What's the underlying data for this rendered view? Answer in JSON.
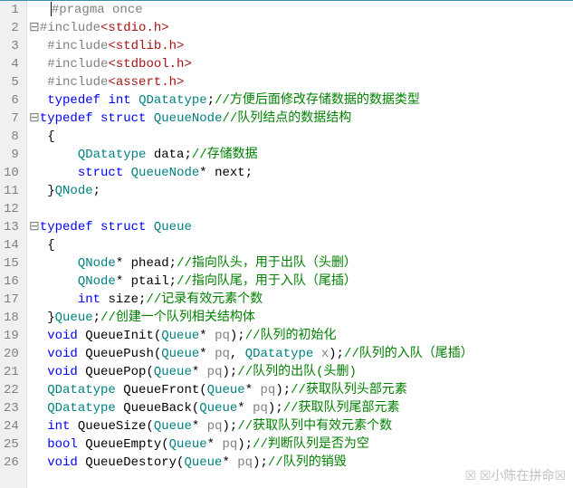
{
  "watermark": "☒ ☒小陈在拼命☒",
  "lines": [
    {
      "n": 1,
      "fold": "",
      "tokens": [
        {
          "t": "",
          "c": "fold"
        },
        {
          "t": "|",
          "c": "cursor"
        },
        {
          "t": "#pragma once",
          "c": "pp"
        }
      ]
    },
    {
      "n": 2,
      "fold": "⊟",
      "tokens": [
        {
          "t": "#include",
          "c": "pp"
        },
        {
          "t": "<stdio.h>",
          "c": "str"
        }
      ]
    },
    {
      "n": 3,
      "fold": "",
      "tokens": [
        {
          "t": " ",
          "c": ""
        },
        {
          "t": "#include",
          "c": "pp"
        },
        {
          "t": "<stdlib.h>",
          "c": "str"
        }
      ]
    },
    {
      "n": 4,
      "fold": "",
      "tokens": [
        {
          "t": " ",
          "c": ""
        },
        {
          "t": "#include",
          "c": "pp"
        },
        {
          "t": "<stdbool.h>",
          "c": "str"
        }
      ]
    },
    {
      "n": 5,
      "fold": "",
      "tokens": [
        {
          "t": " ",
          "c": ""
        },
        {
          "t": "#include",
          "c": "pp"
        },
        {
          "t": "<assert.h>",
          "c": "str"
        }
      ]
    },
    {
      "n": 6,
      "fold": "",
      "tokens": [
        {
          "t": " ",
          "c": ""
        },
        {
          "t": "typedef",
          "c": "kw"
        },
        {
          "t": " ",
          "c": ""
        },
        {
          "t": "int",
          "c": "kw"
        },
        {
          "t": " ",
          "c": ""
        },
        {
          "t": "QDatatype",
          "c": "type"
        },
        {
          "t": ";",
          "c": "op"
        },
        {
          "t": "//方便后面修改存储数据的数据类型",
          "c": "cmt"
        }
      ]
    },
    {
      "n": 7,
      "fold": "⊟",
      "tokens": [
        {
          "t": "typedef",
          "c": "kw"
        },
        {
          "t": " ",
          "c": ""
        },
        {
          "t": "struct",
          "c": "kw"
        },
        {
          "t": " ",
          "c": ""
        },
        {
          "t": "QueueNode",
          "c": "type"
        },
        {
          "t": "//队列结点的数据结构",
          "c": "cmt"
        }
      ]
    },
    {
      "n": 8,
      "fold": "",
      "tokens": [
        {
          "t": " {",
          "c": "op"
        }
      ]
    },
    {
      "n": 9,
      "fold": "",
      "tokens": [
        {
          "t": "     ",
          "c": ""
        },
        {
          "t": "QDatatype",
          "c": "type"
        },
        {
          "t": " data;",
          "c": "op"
        },
        {
          "t": "//存储数据",
          "c": "cmt"
        }
      ]
    },
    {
      "n": 10,
      "fold": "",
      "tokens": [
        {
          "t": "     ",
          "c": ""
        },
        {
          "t": "struct",
          "c": "kw"
        },
        {
          "t": " ",
          "c": ""
        },
        {
          "t": "QueueNode",
          "c": "type"
        },
        {
          "t": "* next;",
          "c": "op"
        }
      ]
    },
    {
      "n": 11,
      "fold": "",
      "tokens": [
        {
          "t": " }",
          "c": "op"
        },
        {
          "t": "QNode",
          "c": "type"
        },
        {
          "t": ";",
          "c": "op"
        }
      ]
    },
    {
      "n": 12,
      "fold": "",
      "tokens": [
        {
          "t": "",
          "c": ""
        }
      ]
    },
    {
      "n": 13,
      "fold": "⊟",
      "tokens": [
        {
          "t": "typedef",
          "c": "kw"
        },
        {
          "t": " ",
          "c": ""
        },
        {
          "t": "struct",
          "c": "kw"
        },
        {
          "t": " ",
          "c": ""
        },
        {
          "t": "Queue",
          "c": "type"
        }
      ]
    },
    {
      "n": 14,
      "fold": "",
      "tokens": [
        {
          "t": " {",
          "c": "op"
        }
      ]
    },
    {
      "n": 15,
      "fold": "",
      "tokens": [
        {
          "t": "     ",
          "c": ""
        },
        {
          "t": "QNode",
          "c": "type"
        },
        {
          "t": "* phead;",
          "c": "op"
        },
        {
          "t": "//指向队头，用于出队（头删）",
          "c": "cmt"
        }
      ]
    },
    {
      "n": 16,
      "fold": "",
      "tokens": [
        {
          "t": "     ",
          "c": ""
        },
        {
          "t": "QNode",
          "c": "type"
        },
        {
          "t": "* ptail;",
          "c": "op"
        },
        {
          "t": "//指向队尾，用于入队（尾插）",
          "c": "cmt"
        }
      ]
    },
    {
      "n": 17,
      "fold": "",
      "tokens": [
        {
          "t": "     ",
          "c": ""
        },
        {
          "t": "int",
          "c": "kw"
        },
        {
          "t": " size;",
          "c": "op"
        },
        {
          "t": "//记录有效元素个数",
          "c": "cmt"
        }
      ]
    },
    {
      "n": 18,
      "fold": "",
      "tokens": [
        {
          "t": " }",
          "c": "op"
        },
        {
          "t": "Queue",
          "c": "type"
        },
        {
          "t": ";",
          "c": "op"
        },
        {
          "t": "//创建一个队列相关结构体",
          "c": "cmt"
        }
      ]
    },
    {
      "n": 19,
      "fold": "",
      "tokens": [
        {
          "t": " ",
          "c": ""
        },
        {
          "t": "void",
          "c": "kw"
        },
        {
          "t": " QueueInit(",
          "c": "op"
        },
        {
          "t": "Queue",
          "c": "type"
        },
        {
          "t": "* ",
          "c": "op"
        },
        {
          "t": "pq",
          "c": "pp"
        },
        {
          "t": ");",
          "c": "op"
        },
        {
          "t": "//队列的初始化",
          "c": "cmt"
        }
      ]
    },
    {
      "n": 20,
      "fold": "",
      "tokens": [
        {
          "t": " ",
          "c": ""
        },
        {
          "t": "void",
          "c": "kw"
        },
        {
          "t": " QueuePush(",
          "c": "op"
        },
        {
          "t": "Queue",
          "c": "type"
        },
        {
          "t": "* ",
          "c": "op"
        },
        {
          "t": "pq",
          "c": "pp"
        },
        {
          "t": ", ",
          "c": "op"
        },
        {
          "t": "QDatatype",
          "c": "type"
        },
        {
          "t": " ",
          "c": ""
        },
        {
          "t": "x",
          "c": "pp"
        },
        {
          "t": ");",
          "c": "op"
        },
        {
          "t": "//队列的入队（尾插）",
          "c": "cmt"
        }
      ]
    },
    {
      "n": 21,
      "fold": "",
      "tokens": [
        {
          "t": " ",
          "c": ""
        },
        {
          "t": "void",
          "c": "kw"
        },
        {
          "t": " QueuePop(",
          "c": "op"
        },
        {
          "t": "Queue",
          "c": "type"
        },
        {
          "t": "* ",
          "c": "op"
        },
        {
          "t": "pq",
          "c": "pp"
        },
        {
          "t": ");",
          "c": "op"
        },
        {
          "t": "//队列的出队(头删)",
          "c": "cmt"
        }
      ]
    },
    {
      "n": 22,
      "fold": "",
      "tokens": [
        {
          "t": " ",
          "c": ""
        },
        {
          "t": "QDatatype",
          "c": "type"
        },
        {
          "t": " QueueFront(",
          "c": "op"
        },
        {
          "t": "Queue",
          "c": "type"
        },
        {
          "t": "* ",
          "c": "op"
        },
        {
          "t": "pq",
          "c": "pp"
        },
        {
          "t": ");",
          "c": "op"
        },
        {
          "t": "//获取队列头部元素",
          "c": "cmt"
        }
      ]
    },
    {
      "n": 23,
      "fold": "",
      "tokens": [
        {
          "t": " ",
          "c": ""
        },
        {
          "t": "QDatatype",
          "c": "type"
        },
        {
          "t": " QueueBack(",
          "c": "op"
        },
        {
          "t": "Queue",
          "c": "type"
        },
        {
          "t": "* ",
          "c": "op"
        },
        {
          "t": "pq",
          "c": "pp"
        },
        {
          "t": ");",
          "c": "op"
        },
        {
          "t": "//获取队列尾部元素",
          "c": "cmt"
        }
      ]
    },
    {
      "n": 24,
      "fold": "",
      "tokens": [
        {
          "t": " ",
          "c": ""
        },
        {
          "t": "int",
          "c": "kw"
        },
        {
          "t": " QueueSize(",
          "c": "op"
        },
        {
          "t": "Queue",
          "c": "type"
        },
        {
          "t": "* ",
          "c": "op"
        },
        {
          "t": "pq",
          "c": "pp"
        },
        {
          "t": ");",
          "c": "op"
        },
        {
          "t": "//获取队列中有效元素个数",
          "c": "cmt"
        }
      ]
    },
    {
      "n": 25,
      "fold": "",
      "tokens": [
        {
          "t": " ",
          "c": ""
        },
        {
          "t": "bool",
          "c": "kw"
        },
        {
          "t": " QueueEmpty(",
          "c": "op"
        },
        {
          "t": "Queue",
          "c": "type"
        },
        {
          "t": "* ",
          "c": "op"
        },
        {
          "t": "pq",
          "c": "pp"
        },
        {
          "t": ");",
          "c": "op"
        },
        {
          "t": "//判断队列是否为空",
          "c": "cmt"
        }
      ]
    },
    {
      "n": 26,
      "fold": "",
      "tokens": [
        {
          "t": " ",
          "c": ""
        },
        {
          "t": "void",
          "c": "kw"
        },
        {
          "t": " QueueDestory(",
          "c": "op"
        },
        {
          "t": "Queue",
          "c": "type"
        },
        {
          "t": "* ",
          "c": "op"
        },
        {
          "t": "pq",
          "c": "pp"
        },
        {
          "t": ");",
          "c": "op"
        },
        {
          "t": "//队列的销毁",
          "c": "cmt"
        }
      ]
    }
  ]
}
